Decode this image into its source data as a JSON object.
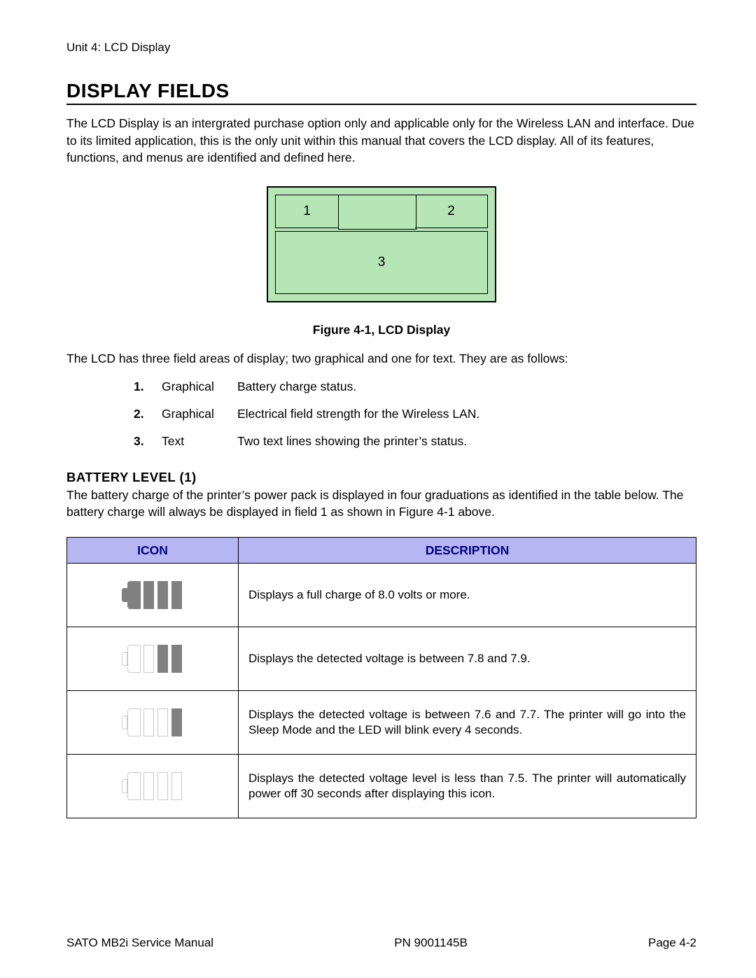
{
  "header": {
    "unit": "Unit 4: LCD Display"
  },
  "title": "DISPLAY FIELDS",
  "intro": "The LCD Display is an intergrated purchase option only and applicable only for the Wireless LAN and interface. Due to its limited application, this is the only unit within this manual that covers the LCD display. All of its features, functions, and menus are identified and defined here.",
  "diagram": {
    "cell1": "1",
    "cell2": "2",
    "cell3": "3"
  },
  "fig_caption": "Figure 4-1, LCD Display",
  "fields_intro": "The LCD has three field areas of display; two graphical and one for text. They are as follows:",
  "fields": [
    {
      "num": "1.",
      "kind": "Graphical",
      "desc": "Battery charge status."
    },
    {
      "num": "2.",
      "kind": "Graphical",
      "desc": "Electrical field strength for the Wireless LAN."
    },
    {
      "num": "3.",
      "kind": "Text",
      "desc": "Two text lines showing the printer’s status."
    }
  ],
  "battery_section_title": "BATTERY LEVEL (1)",
  "battery_intro": "The battery charge of the printer’s power pack is displayed in four graduations as identified in the table below. The battery charge will always be displayed in field 1 as shown in Figure 4-1 above.",
  "table": {
    "head_icon": "ICON",
    "head_desc": "DESCRIPTION",
    "rows": [
      {
        "desc": "Displays a full charge of 8.0 volts or more."
      },
      {
        "desc": "Displays the detected voltage is between 7.8 and 7.9."
      },
      {
        "desc": "Displays the detected voltage is between 7.6 and 7.7. The printer will go into the Sleep Mode and the LED will blink every 4 seconds."
      },
      {
        "desc": "Displays the detected voltage level is less than 7.5. The printer will automatically power off 30 seconds after displaying this icon."
      }
    ]
  },
  "footer": {
    "manual": "SATO MB2i Service Manual",
    "pn": "PN  9001145B",
    "page": "Page 4-2"
  }
}
